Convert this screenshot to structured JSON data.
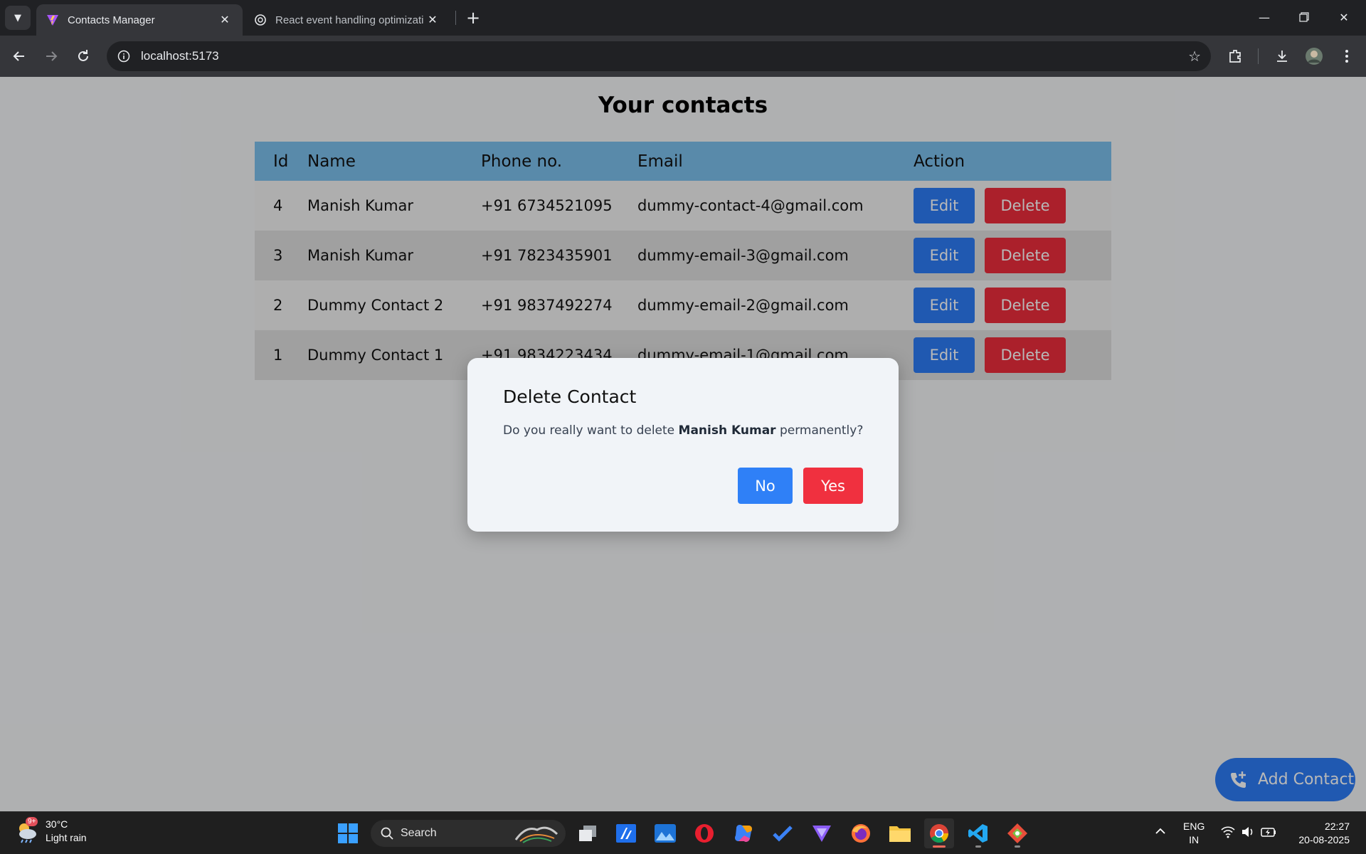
{
  "browser": {
    "tabs": [
      {
        "title": "Contacts Manager",
        "active": true
      },
      {
        "title": "React event handling optimizati",
        "active": false
      }
    ],
    "url": "localhost:5173"
  },
  "page": {
    "heading": "Your contacts",
    "table": {
      "columns": [
        "Id",
        "Name",
        "Phone no.",
        "Email",
        "Action"
      ],
      "rows": [
        {
          "id": "4",
          "name": "Manish Kumar",
          "phone": "+91 6734521095",
          "email": "dummy-contact-4@gmail.com"
        },
        {
          "id": "3",
          "name": "Manish Kumar",
          "phone": "+91 7823435901",
          "email": "dummy-email-3@gmail.com"
        },
        {
          "id": "2",
          "name": "Dummy Contact 2",
          "phone": "+91 9837492274",
          "email": "dummy-email-2@gmail.com"
        },
        {
          "id": "1",
          "name": "Dummy Contact 1",
          "phone": "+91 9834223434",
          "email": "dummy-email-1@gmail.com"
        }
      ],
      "edit_label": "Edit",
      "delete_label": "Delete"
    },
    "add_contact_label": "Add Contact"
  },
  "modal": {
    "title": "Delete Contact",
    "text_before": "Do you really want to delete ",
    "contact_name": "Manish Kumar",
    "text_after": " permanently?",
    "no_label": "No",
    "yes_label": "Yes"
  },
  "taskbar": {
    "weather_badge": "9+",
    "temperature": "30°C",
    "condition": "Light rain",
    "search_placeholder": "Search",
    "lang_line1": "ENG",
    "lang_line2": "IN",
    "time": "22:27",
    "date": "20-08-2025"
  },
  "colors": {
    "header_row": "#7cbfec",
    "edit_button": "#2d7cf6",
    "delete_button": "#ee2d3c",
    "modal_no": "#2f80f7",
    "modal_yes": "#f0303f"
  }
}
